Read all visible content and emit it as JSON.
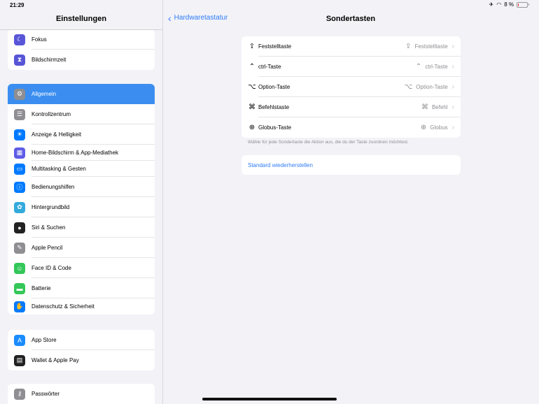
{
  "status_bar": {
    "time": "21:29",
    "battery_percent": "8 %"
  },
  "sidebar": {
    "title": "Einstellungen",
    "groups": [
      {
        "items": [
          {
            "label": "Fokus",
            "icon": "moon-icon",
            "color": "#5856d6"
          },
          {
            "label": "Bildschirmzeit",
            "icon": "hourglass-icon",
            "color": "#5856d6"
          }
        ]
      },
      {
        "items": [
          {
            "label": "Allgemein",
            "icon": "gear-icon",
            "color": "#8e8e93",
            "selected": true
          },
          {
            "label": "Kontrollzentrum",
            "icon": "switches-icon",
            "color": "#8e8e93"
          },
          {
            "label": "Anzeige & Helligkeit",
            "icon": "sun-icon",
            "color": "#007aff"
          },
          {
            "label": "Home-Bildschirm & App-Mediathek",
            "icon": "grid-icon",
            "color": "#5e5ce6"
          },
          {
            "label": "Multitasking & Gesten",
            "icon": "multitasking-icon",
            "color": "#007aff"
          },
          {
            "label": "Bedienungshilfen",
            "icon": "accessibility-icon",
            "color": "#007aff"
          },
          {
            "label": "Hintergrundbild",
            "icon": "flower-icon",
            "color": "#34aadc"
          },
          {
            "label": "Siri & Suchen",
            "icon": "siri-icon",
            "color": "#222222"
          },
          {
            "label": "Apple Pencil",
            "icon": "pencil-icon",
            "color": "#8e8e93"
          },
          {
            "label": "Face ID & Code",
            "icon": "faceid-icon",
            "color": "#34c759"
          },
          {
            "label": "Batterie",
            "icon": "battery-icon",
            "color": "#34c759"
          },
          {
            "label": "Datenschutz & Sicherheit",
            "icon": "hand-icon",
            "color": "#007aff"
          }
        ]
      },
      {
        "items": [
          {
            "label": "App Store",
            "icon": "appstore-icon",
            "color": "#1a8cff"
          },
          {
            "label": "Wallet & Apple Pay",
            "icon": "wallet-icon",
            "color": "#222222"
          }
        ]
      },
      {
        "items": [
          {
            "label": "Passwörter",
            "icon": "key-icon",
            "color": "#8e8e93"
          }
        ]
      }
    ]
  },
  "detail": {
    "back_label": "Hardwaretastatur",
    "title": "Sondertasten",
    "keys": [
      {
        "label": "Feststelltaste",
        "value": "Feststelltaste",
        "icon": "capslock-icon"
      },
      {
        "label": "ctrl-Taste",
        "value": "ctrl-Taste",
        "icon": "control-icon"
      },
      {
        "label": "Option-Taste",
        "value": "Option-Taste",
        "icon": "option-icon"
      },
      {
        "label": "Befehlstaste",
        "value": "Befehl",
        "icon": "command-icon"
      },
      {
        "label": "Globus-Taste",
        "value": "Globus",
        "icon": "globe-icon"
      }
    ],
    "footnote": "Wähle für jede Sondertaste die Aktion aus, die du der Taste zuordnen möchtest.",
    "restore_label": "Standard wiederherstellen"
  }
}
